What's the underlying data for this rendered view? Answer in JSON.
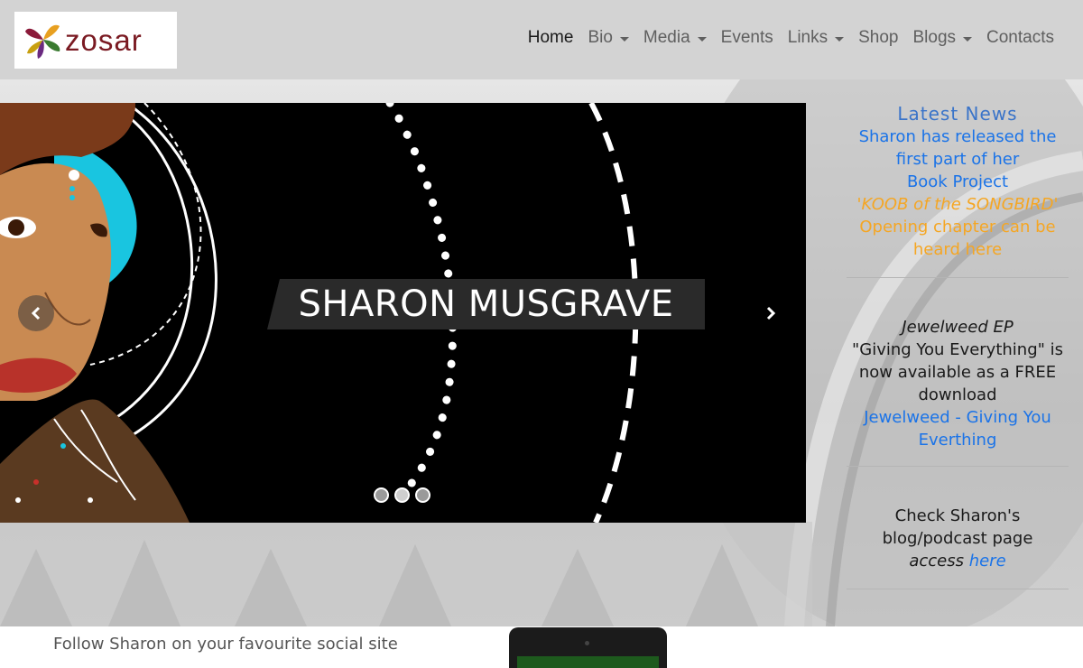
{
  "logo": {
    "text": "zosar",
    "icon": "pinwheel-logo-icon"
  },
  "nav": [
    {
      "label": "Home",
      "active": true,
      "dropdown": false
    },
    {
      "label": "Bio",
      "active": false,
      "dropdown": true
    },
    {
      "label": "Media",
      "active": false,
      "dropdown": true
    },
    {
      "label": "Events",
      "active": false,
      "dropdown": false
    },
    {
      "label": "Links",
      "active": false,
      "dropdown": true
    },
    {
      "label": "Shop",
      "active": false,
      "dropdown": false
    },
    {
      "label": "Blogs",
      "active": false,
      "dropdown": true
    },
    {
      "label": "Contacts",
      "active": false,
      "dropdown": false
    }
  ],
  "carousel": {
    "caption": "SHARON MUSGRAVE",
    "prev_icon": "chevron-left-icon",
    "next_icon": "chevron-right-icon",
    "slide_count": 3,
    "active_slide": 2
  },
  "news": {
    "title": "Latest News",
    "item1": {
      "line1": "Sharon has released the first part of her",
      "line2": "Book Project",
      "line3": "'KOOB of the SONGBIRD'",
      "line4": "Opening chapter can be heard here"
    },
    "item2": {
      "title": "Jewelweed EP",
      "text": "\"Giving You Everything\" is now available as a FREE download",
      "link": "Jewelweed - Giving You Everthing"
    },
    "item3": {
      "text": "Check Sharon's blog/podcast page",
      "access": "access",
      "link": "here"
    }
  },
  "footer": {
    "follow_text": "Follow Sharon on your favourite social site"
  },
  "colors": {
    "navbar": "#d3d3d3",
    "link_blue": "#1a73e8",
    "orange": "#f5a623",
    "logo_red": "#7a1a22"
  }
}
